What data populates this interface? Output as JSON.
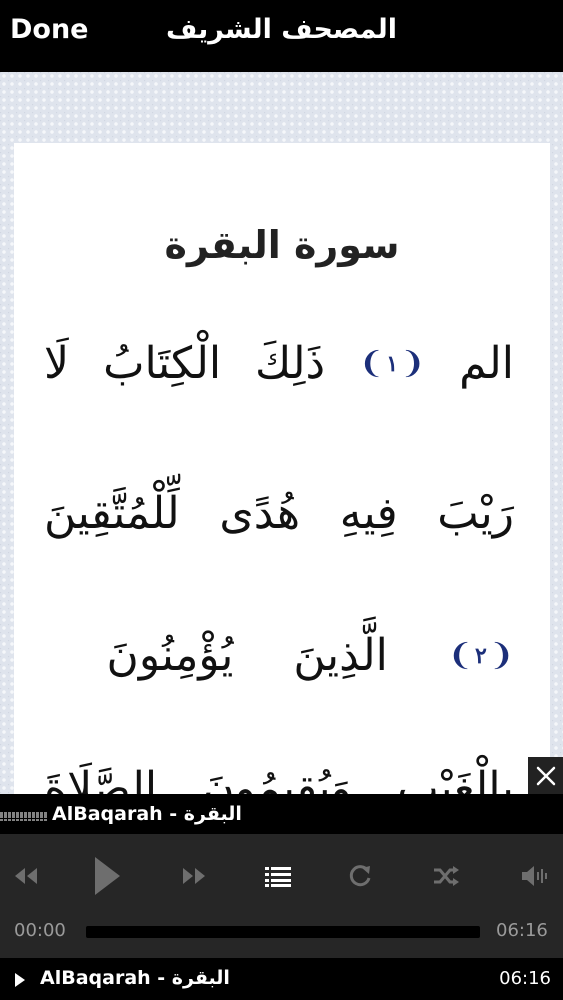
{
  "topbar": {
    "done_label": "Done",
    "title": "المصحف الشريف"
  },
  "page": {
    "surah_title": "سورة البقرة",
    "lines": [
      {
        "words": [
          "الم",
          "ذَلِكَ",
          "الْكِتَابُ",
          "لَا"
        ],
        "ayah_after_word": 0,
        "ayah_number": "١"
      },
      {
        "words": [
          "رَيْبَ",
          "فِيهِ",
          "هُدًى",
          "لِّلْمُتَّقِينَ"
        ]
      },
      {
        "words": [
          "الَّذِينَ",
          "يُؤْمِنُونَ"
        ],
        "ayah_before_word": 0,
        "ayah_number": "٢"
      },
      {
        "words": [
          "بِالْغَيْبِ",
          "وَيُقِيمُونَ",
          "الصَّلَاةَ"
        ]
      }
    ]
  },
  "player": {
    "track_title": "AlBaqarah - البقرة",
    "current_time": "00:00",
    "total_time": "06:16",
    "progress": 0.0,
    "controls": [
      "rewind-icon",
      "play-icon",
      "fast-forward-icon",
      "playlist-icon",
      "repeat-icon",
      "shuffle-icon",
      "volume-icon"
    ],
    "queue_title": "AlBaqarah - البقرة",
    "queue_time": "06:16"
  },
  "colors": {
    "accent": "#1c2f7a",
    "progress": "#5a8ad8"
  }
}
